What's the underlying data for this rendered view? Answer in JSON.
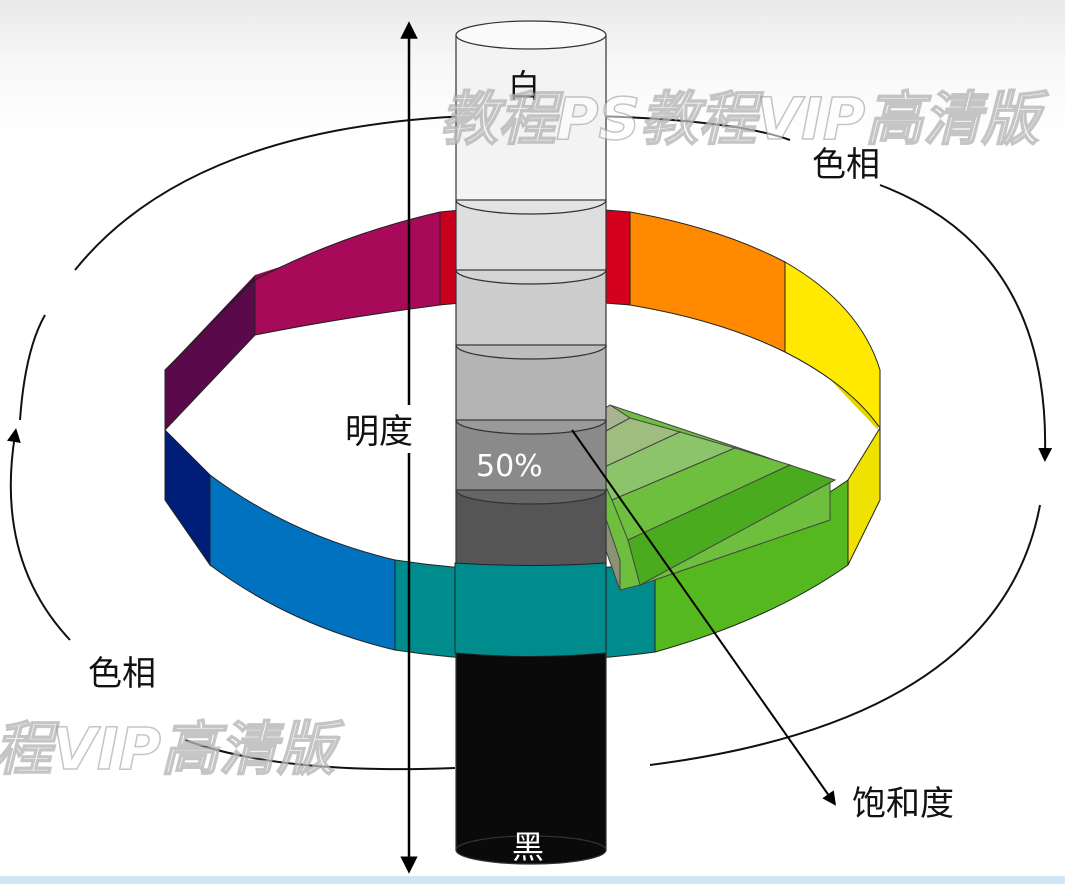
{
  "labels": {
    "white": "白",
    "black": "黑",
    "lightness": "明度",
    "hue_top": "色相",
    "hue_left": "色相",
    "saturation": "饱和度",
    "mid_value": "50%"
  },
  "watermark": {
    "top": "教程PS教程VIP高清版",
    "left": "程VIP高清版"
  },
  "colors": {
    "wheel": [
      "#c8001e",
      "#ff8a00",
      "#ffe900",
      "#55b81e",
      "#008c8c",
      "#0072c0",
      "#001e78",
      "#5a0a4a",
      "#a80a5a"
    ],
    "column_top": "#f3f3f3",
    "column_bottom": "#0a0a0a",
    "saturation_wedge": [
      "#a9b392",
      "#9ebd7e",
      "#8cc46c",
      "#6fbf3f",
      "#4aab1e"
    ]
  },
  "icons": [
    "up-down-arrow-icon",
    "arrow-head-icon"
  ]
}
